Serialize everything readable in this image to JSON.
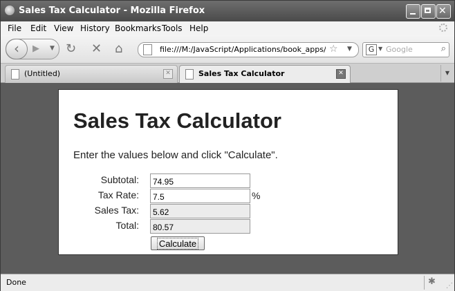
{
  "window": {
    "title": "Sales Tax Calculator - Mozilla Firefox"
  },
  "menu": {
    "items": [
      "File",
      "Edit",
      "View",
      "History",
      "Bookmarks",
      "Tools",
      "Help"
    ]
  },
  "navbar": {
    "url": "file:///M:/JavaScript/Applications/book_apps/chap",
    "search_engine_glyph": "G",
    "search_placeholder": "Google"
  },
  "tabs": [
    {
      "label": "(Untitled)",
      "active": false
    },
    {
      "label": "Sales Tax Calculator",
      "active": true
    }
  ],
  "page": {
    "heading": "Sales Tax Calculator",
    "instructions": "Enter the values below and click \"Calculate\".",
    "fields": {
      "subtotal": {
        "label": "Subtotal:",
        "value": "74.95"
      },
      "tax_rate": {
        "label": "Tax Rate:",
        "value": "7.5",
        "suffix": "%"
      },
      "sales_tax": {
        "label": "Sales Tax:",
        "value": "5.62"
      },
      "total": {
        "label": "Total:",
        "value": "80.57"
      }
    },
    "calculate_label": "Calculate"
  },
  "status": {
    "text": "Done"
  }
}
